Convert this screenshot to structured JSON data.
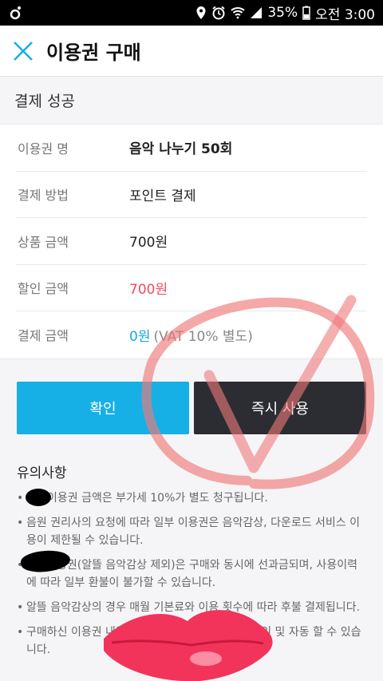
{
  "status_bar": {
    "battery": "35%",
    "time": "오전 3:00",
    "icons": [
      "location-icon",
      "alarm-icon",
      "wifi-icon",
      "signal-icon",
      "battery-icon"
    ]
  },
  "app_bar": {
    "title": "이용권 구매",
    "close_icon": "close-icon"
  },
  "section": {
    "title": "결제 성공"
  },
  "info_rows": [
    {
      "label": "이용권 명",
      "value": "음악 나누기 50회"
    },
    {
      "label": "결제 방법",
      "value": "포인트 결제"
    },
    {
      "label": "상품 금액",
      "value": "700원"
    },
    {
      "label": "할인 금액",
      "value": "700원"
    },
    {
      "label": "결제 금액",
      "value": "0원",
      "note": "(VAT 10% 별도)"
    }
  ],
  "buttons": {
    "confirm": "확인",
    "use_now": "즉시 사용"
  },
  "notice": {
    "title": "유의사항",
    "items": [
      "이용권 금액은 부가세 10%가 별도 청구됩니다.",
      "음원 권리사의 요청에 따라 일부 이용권은 음악감상, 다운로드 서비스 이용이 제한될 수 있습니다.",
      "용권(알뜰 음악감상 제외)은 구매와 동시에 선과금되며, 사용이력에 따라 일부 환불이 불가할 수 있습니다.",
      "알뜰 음악감상의 경우 매월 기본료와 이용 횟수에 따라 후불 결제됩니다.",
      "구매하신 이용권                    내역]에서 상세 내용, 결제방법 확인 및 자동                  할 수 있습니다."
    ]
  },
  "colors": {
    "primary": "#17b0e6",
    "dark_button": "#2c2d33",
    "discount": "#ef4c5c",
    "pay_amount": "#1aa6e0",
    "checkmark_overlay": "#f07a7a",
    "lips": "#f2345a"
  }
}
